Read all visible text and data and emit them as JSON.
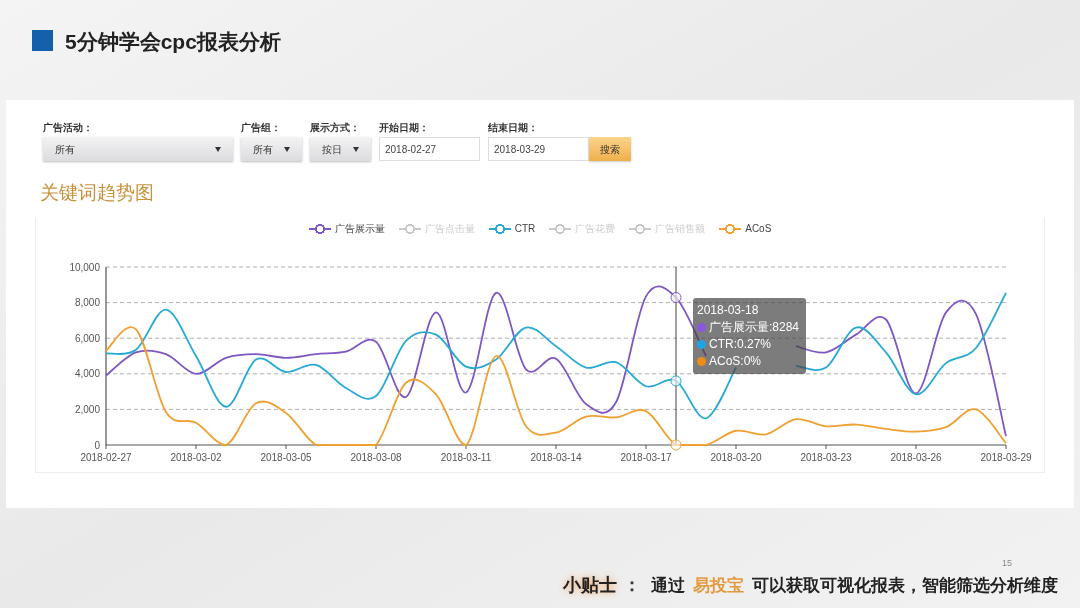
{
  "slide_title": "5分钟学会cpc报表分析",
  "filters": [
    {
      "kind": "select",
      "label": "广告活动：",
      "value": "所有"
    },
    {
      "kind": "select",
      "label": "广告组：",
      "value": "所有"
    },
    {
      "kind": "select",
      "label": "展示方式：",
      "value": "按日"
    },
    {
      "kind": "date",
      "label": "开始日期：",
      "value": "2018-02-27"
    },
    {
      "kind": "date",
      "label": "结束日期：",
      "value": "2018-03-29"
    }
  ],
  "search_button": "搜索",
  "section_title": "关键词趋势图",
  "legend": [
    {
      "label": "广告展示量",
      "color": "#7e57c2",
      "selected": true
    },
    {
      "label": "广告点击量",
      "color": "#c9c9c9",
      "selected": false
    },
    {
      "label": "CTR",
      "color": "#26a9d4",
      "selected": true
    },
    {
      "label": "广告花费",
      "color": "#c9c9c9",
      "selected": false
    },
    {
      "label": "广告销售额",
      "color": "#c9c9c9",
      "selected": false
    },
    {
      "label": "ACoS",
      "color": "#f0a030",
      "selected": true
    }
  ],
  "chart_data": {
    "type": "line",
    "ylim": [
      0,
      10000
    ],
    "categories": [
      "2018-02-27",
      null,
      null,
      "2018-03-02",
      null,
      null,
      "2018-03-05",
      null,
      null,
      "2018-03-08",
      null,
      null,
      "2018-03-11",
      null,
      null,
      "2018-03-14",
      null,
      null,
      "2018-03-17",
      null,
      null,
      "2018-03-20",
      null,
      null,
      "2018-03-23",
      null,
      null,
      "2018-03-26",
      null,
      null,
      "2018-03-29"
    ],
    "grid": true,
    "yticks": [
      {
        "value": 0,
        "label": "0"
      },
      {
        "value": 2000,
        "label": "2,000"
      },
      {
        "value": 4000,
        "label": "4,000"
      },
      {
        "value": 6000,
        "label": "6,000"
      },
      {
        "value": 8000,
        "label": "8,000"
      },
      {
        "value": 10000,
        "label": "10,000"
      }
    ],
    "series": [
      {
        "color": "#7e57c2",
        "values": [
          3900,
          5200,
          5100,
          4000,
          4900,
          5100,
          4900,
          5100,
          5250,
          5800,
          2700,
          7450,
          2950,
          8550,
          4250,
          4850,
          2300,
          2400,
          8350,
          8284,
          5000,
          null,
          null,
          5550,
          5200,
          6200,
          7050,
          2900,
          7450,
          7350,
          500
        ]
      },
      {
        "color": "#26a9d4",
        "values": [
          5150,
          5350,
          7600,
          5000,
          2150,
          4800,
          4100,
          4500,
          3200,
          2750,
          5850,
          6200,
          4400,
          4800,
          6600,
          5550,
          4350,
          4650,
          3300,
          3600,
          1500,
          4350,
          null,
          4450,
          4350,
          6600,
          5200,
          2850,
          4600,
          5450,
          8550
        ]
      },
      {
        "color": "#f0a030",
        "values": [
          5300,
          6500,
          1850,
          1250,
          0,
          2350,
          1800,
          0,
          0,
          0,
          3500,
          2850,
          0,
          5000,
          1050,
          700,
          1600,
          1550,
          1900,
          0,
          0,
          800,
          600,
          1450,
          1050,
          1150,
          900,
          750,
          1000,
          2000,
          100
        ]
      }
    ]
  },
  "tooltip": {
    "title": "2018-03-18",
    "items": [
      {
        "text": "广告展示量:8284",
        "color": "#8b55e0"
      },
      {
        "text": "CTR:0.27%",
        "color": "#1fa3e6"
      },
      {
        "text": "ACoS:0%",
        "color": "#f08a1a"
      }
    ]
  },
  "tip": {
    "label": "小贴士",
    "separator": "：",
    "text_before": "通过",
    "highlight": "易投宝",
    "text_after": "可以获取可视化报表，智能筛选分析维度"
  },
  "page_number": "15"
}
